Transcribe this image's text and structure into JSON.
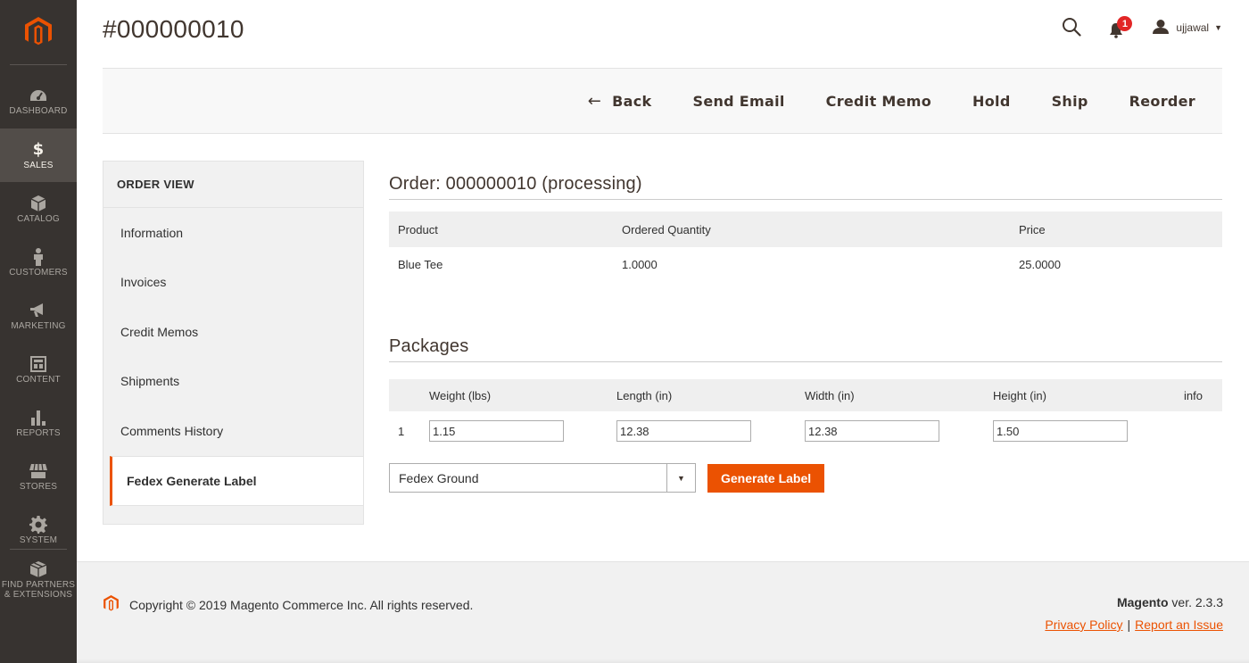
{
  "menu": {
    "items": [
      {
        "label": "DASHBOARD",
        "icon": "dashboard-icon"
      },
      {
        "label": "SALES",
        "icon": "dollar-icon"
      },
      {
        "label": "CATALOG",
        "icon": "box-icon"
      },
      {
        "label": "CUSTOMERS",
        "icon": "person-icon"
      },
      {
        "label": "MARKETING",
        "icon": "megaphone-icon"
      },
      {
        "label": "CONTENT",
        "icon": "layout-icon"
      },
      {
        "label": "REPORTS",
        "icon": "bar-chart-icon"
      },
      {
        "label": "STORES",
        "icon": "storefront-icon"
      },
      {
        "label": "SYSTEM",
        "icon": "gear-icon"
      }
    ],
    "partners_line1": "FIND PARTNERS",
    "partners_line2": "& EXTENSIONS",
    "active": "SALES"
  },
  "header": {
    "title": "#000000010",
    "notification_count": "1",
    "username": "ujjawal"
  },
  "actions": {
    "back": "Back",
    "send_email": "Send Email",
    "credit_memo": "Credit Memo",
    "hold": "Hold",
    "ship": "Ship",
    "reorder": "Reorder"
  },
  "side_tabs": {
    "title": "ORDER VIEW",
    "items": [
      "Information",
      "Invoices",
      "Credit Memos",
      "Shipments",
      "Comments History",
      "Fedex Generate Label"
    ],
    "active": "Fedex Generate Label"
  },
  "order": {
    "title": "Order: 000000010 (processing)",
    "columns": [
      "Product",
      "Ordered Quantity",
      "Price"
    ],
    "rows": [
      {
        "product": "Blue Tee",
        "qty": "1.0000",
        "price": "25.0000"
      }
    ]
  },
  "packages": {
    "title": "Packages",
    "columns": [
      "Weight (lbs)",
      "Length (in)",
      "Width (in)",
      "Height (in)",
      "info"
    ],
    "rows": [
      {
        "index": "1",
        "weight": "1.15",
        "length": "12.38",
        "width": "12.38",
        "height": "1.50"
      }
    ]
  },
  "shipping": {
    "method": "Fedex Ground",
    "generate_label": "Generate Label"
  },
  "footer": {
    "copyright": "Copyright © 2019 Magento Commerce Inc. All rights reserved.",
    "brand": "Magento",
    "version": " ver. 2.3.3",
    "privacy": "Privacy Policy",
    "separator": "|",
    "report": "Report an Issue"
  },
  "colors": {
    "accent": "#eb5202",
    "menu_bg": "#373330",
    "menu_active": "#524d49"
  }
}
